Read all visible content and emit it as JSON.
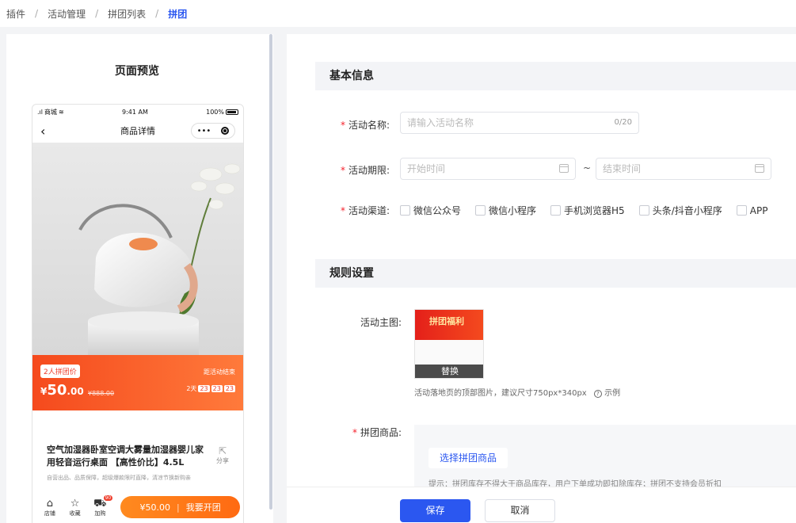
{
  "breadcrumb": [
    "插件",
    "活动管理",
    "拼团列表",
    "拼团"
  ],
  "preview": {
    "title": "页面预览",
    "status": {
      "carrier": "商城",
      "time": "9:41 AM",
      "battery": "100%"
    },
    "nav_title": "商品详情",
    "group_tag": "2人拼团价",
    "price_symbol": "¥",
    "price_int": "50",
    "price_dec": ".00",
    "orig_price": "¥888.00",
    "end_label": "距活动结束",
    "countdown": {
      "days": "2天",
      "h": "23",
      "m": "23",
      "s": "23"
    },
    "product_name": "空气加湿器卧室空调大雾量加湿器婴儿家用轻音运行桌面 【高性价比】4.5L",
    "share_label": "分享",
    "product_note": "自营出品、品质保障，超级爆款限时直降，清凉节换新购亲",
    "bottom": {
      "store": "店铺",
      "favorite": "收藏",
      "cart": "加购",
      "cart_count": "90",
      "buy_price": "¥50.00",
      "buy_label": "我要开团"
    }
  },
  "form": {
    "basic_title": "基本信息",
    "name_label": "活动名称:",
    "name_placeholder": "请输入活动名称",
    "name_counter": "0/20",
    "period_label": "活动期限:",
    "start_placeholder": "开始时间",
    "end_placeholder": "结束时间",
    "tilde": "~",
    "channel_label": "活动渠道:",
    "channels": [
      "微信公众号",
      "微信小程序",
      "手机浏览器H5",
      "头条/抖音小程序",
      "APP"
    ],
    "rules_title": "规则设置",
    "banner_label": "活动主图:",
    "banner_text": "拼团福利",
    "banner_replace": "替换",
    "banner_hint": "活动落地页的顶部图片，建议尺寸750px*340px",
    "banner_example": "示例",
    "goods_label": "拼团商品:",
    "goods_button": "选择拼团商品",
    "goods_hint": "提示：拼团库存不得大于商品库存，用户下单成功即扣除库存；拼团不支持会员折扣",
    "save": "保存",
    "cancel": "取消"
  },
  "colors": {
    "primary": "#2b57f0",
    "price_band": "#f54a1d",
    "buy_button": "#ff7a1a",
    "required": "#f5222d"
  }
}
